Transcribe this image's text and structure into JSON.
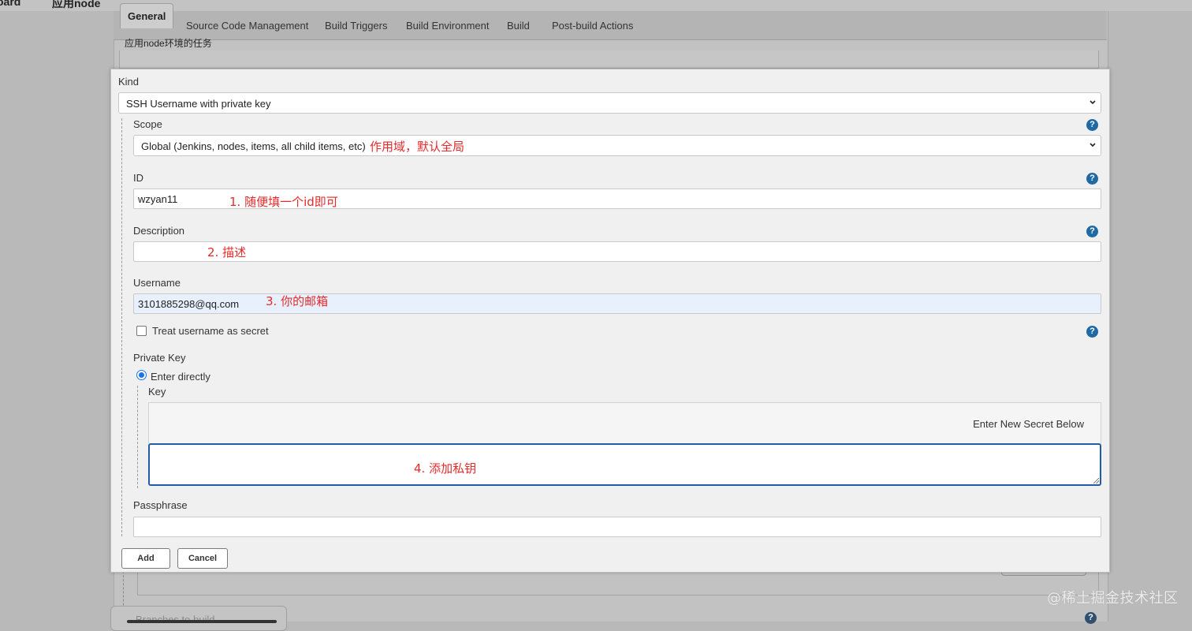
{
  "background": {
    "top_left_partial": "oard",
    "top_job_name_partial": "应用node",
    "tabs": [
      {
        "label": "General",
        "active": true
      },
      {
        "label": "Source Code Management"
      },
      {
        "label": "Build Triggers"
      },
      {
        "label": "Build Environment"
      },
      {
        "label": "Build"
      },
      {
        "label": "Post-build Actions"
      }
    ],
    "description_text": "应用node环境的任务",
    "branches_label": "Branches to build",
    "help_glyph": "?"
  },
  "watermark": "@稀土掘金技术社区",
  "dialog": {
    "kind": {
      "label": "Kind",
      "value": "SSH Username with private key"
    },
    "scope": {
      "label": "Scope",
      "value": "Global (Jenkins, nodes, items, all child items, etc)",
      "annotation": "作用域，默认全局"
    },
    "id": {
      "label": "ID",
      "value": "wzyan11",
      "annotation": "1. 随便填一个id即可"
    },
    "description": {
      "label": "Description",
      "value": "",
      "annotation": "2. 描述"
    },
    "username": {
      "label": "Username",
      "value": "3101885298@qq.com",
      "annotation": "3. 你的邮箱"
    },
    "treat_secret": {
      "label": "Treat username as secret",
      "checked": false
    },
    "private_key": {
      "label": "Private Key",
      "option_label": "Enter directly",
      "selected": true,
      "key_label": "Key",
      "secret_header": "Enter New Secret Below",
      "annotation": "4. 添加私钥"
    },
    "passphrase": {
      "label": "Passphrase",
      "value": ""
    },
    "buttons": {
      "add": "Add",
      "cancel": "Cancel"
    },
    "help_glyph": "?"
  },
  "colors": {
    "annotation_red": "#e42a2a",
    "help_blue": "#1f6aa5",
    "focus_border": "#1f5da8",
    "autofill_bg": "#e8f0fe"
  },
  "icons": [
    "help-icon",
    "chevron-down-icon",
    "checkbox-icon",
    "radio-icon",
    "resize-handle-icon"
  ]
}
